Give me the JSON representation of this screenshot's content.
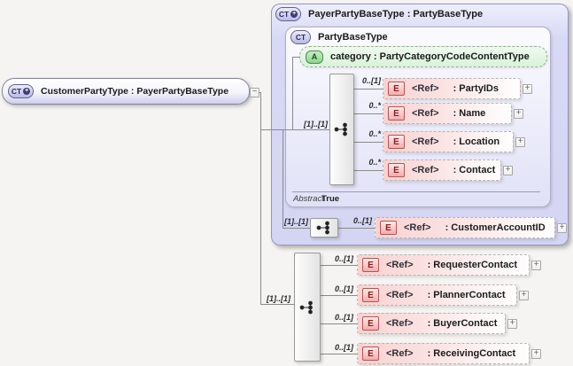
{
  "root_node": {
    "icon": "CT",
    "icon_plus": "+",
    "label": "CustomerPartyType : PayerPartyBaseType",
    "collapse": "−"
  },
  "payer_box": {
    "icon": "CT",
    "icon_plus": "+",
    "title": "PayerPartyBaseType : PartyBaseType",
    "inner_box": {
      "icon": "CT",
      "title": "PartyBaseType",
      "attribute": {
        "icon": "A",
        "label": "category : PartyCategoryCodeContentType"
      },
      "sequence_cardinality": "[1]..[1]",
      "elements": [
        {
          "cardinality": "0..[1]",
          "icon": "E",
          "tag": "<Ref>",
          "name": ": PartyIDs",
          "expand": "+"
        },
        {
          "cardinality": "0..*",
          "icon": "E",
          "tag": "<Ref>",
          "name": ": Name",
          "expand": "+"
        },
        {
          "cardinality": "0..*",
          "icon": "E",
          "tag": "<Ref>",
          "name": ": Location",
          "expand": "+"
        },
        {
          "cardinality": "0..*",
          "icon": "E",
          "tag": "<Ref>",
          "name": ": Contact",
          "expand": "+"
        }
      ],
      "abstract_label": "Abstract",
      "abstract_value": "True"
    },
    "account_row": {
      "sequence_cardinality": "[1]..[1]",
      "cardinality": "0..[1]",
      "icon": "E",
      "tag": "<Ref>",
      "name": ": CustomerAccountID",
      "expand": "+"
    }
  },
  "bottom_group": {
    "sequence_cardinality": "[1]..[1]",
    "elements": [
      {
        "cardinality": "0..[1]",
        "icon": "E",
        "tag": "<Ref>",
        "name": ": RequesterContact",
        "expand": "+"
      },
      {
        "cardinality": "0..[1]",
        "icon": "E",
        "tag": "<Ref>",
        "name": ": PlannerContact",
        "expand": "+"
      },
      {
        "cardinality": "0..[1]",
        "icon": "E",
        "tag": "<Ref>",
        "name": ": BuyerContact",
        "expand": "+"
      },
      {
        "cardinality": "0..[1]",
        "icon": "E",
        "tag": "<Ref>",
        "name": ": ReceivingContact",
        "expand": "+"
      }
    ]
  }
}
